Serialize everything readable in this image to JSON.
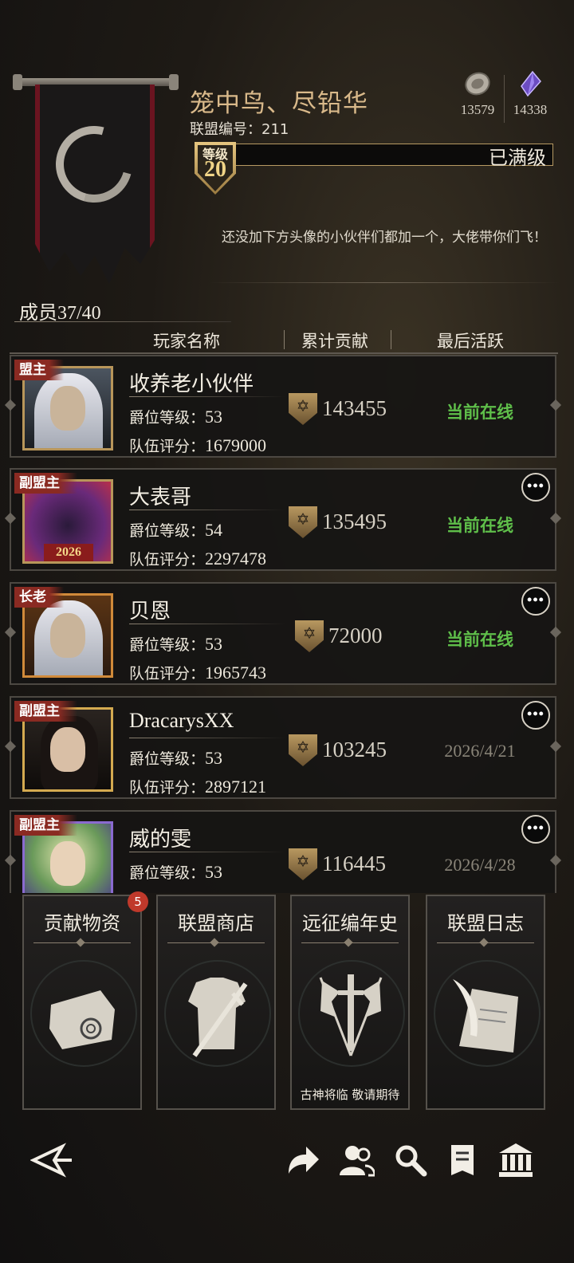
{
  "header": {
    "alliance_name": "笼中鸟、尽铅华",
    "alliance_id_label": "联盟编号：",
    "alliance_id": "211",
    "level_label": "等级",
    "level": "20",
    "level_status": "已满级",
    "notice": "还没加下方头像的小伙伴们都加一个，大佬带你们飞！",
    "resources": [
      {
        "icon": "silver-coin-icon",
        "value": "13579"
      },
      {
        "icon": "purple-crystal-icon",
        "value": "14338"
      }
    ]
  },
  "members": {
    "label": "成员37/40",
    "columns": [
      "玩家名称",
      "累计贡献",
      "最后活跃"
    ],
    "rank_label": "爵位等级：",
    "score_label": "队伍评分：",
    "rows": [
      {
        "role": "盟主",
        "name": "收养老小伙伴",
        "rank": "53",
        "score": "1679000",
        "contribution": "143455",
        "last_active": "当前在线",
        "online": true,
        "has_more": false
      },
      {
        "role": "副盟主",
        "name": "大表哥",
        "rank": "54",
        "score": "2297478",
        "contribution": "135495",
        "last_active": "当前在线",
        "online": true,
        "has_more": true
      },
      {
        "role": "长老",
        "name": "贝恩",
        "rank": "53",
        "score": "1965743",
        "contribution": "72000",
        "last_active": "当前在线",
        "online": true,
        "has_more": true
      },
      {
        "role": "副盟主",
        "name": "DracarysXX",
        "rank": "53",
        "score": "2897121",
        "contribution": "103245",
        "last_active": "2026/4/21",
        "online": false,
        "has_more": true
      },
      {
        "role": "副盟主",
        "name": "威的雯",
        "rank": "53",
        "score": "",
        "contribution": "116445",
        "last_active": "2026/4/28",
        "online": false,
        "has_more": true
      }
    ]
  },
  "cards": [
    {
      "title": "贡献物资",
      "badge": "5",
      "icon": "scroll-icon",
      "subtitle": ""
    },
    {
      "title": "联盟商店",
      "badge": "",
      "icon": "armor-sword-icon",
      "subtitle": ""
    },
    {
      "title": "远征编年史",
      "badge": "",
      "icon": "crossed-flags-sword-icon",
      "subtitle": "古神将临 敬请期待"
    },
    {
      "title": "联盟日志",
      "badge": "",
      "icon": "quill-parchment-icon",
      "subtitle": ""
    }
  ],
  "footer": {
    "icons": [
      "back-arrow-icon",
      "share-icon",
      "members-icon",
      "search-icon",
      "document-icon",
      "hall-icon"
    ]
  },
  "colors": {
    "accent_gold": "#d9b98a",
    "online_green": "#5fbf4a",
    "role_red": "#8a2a22"
  }
}
